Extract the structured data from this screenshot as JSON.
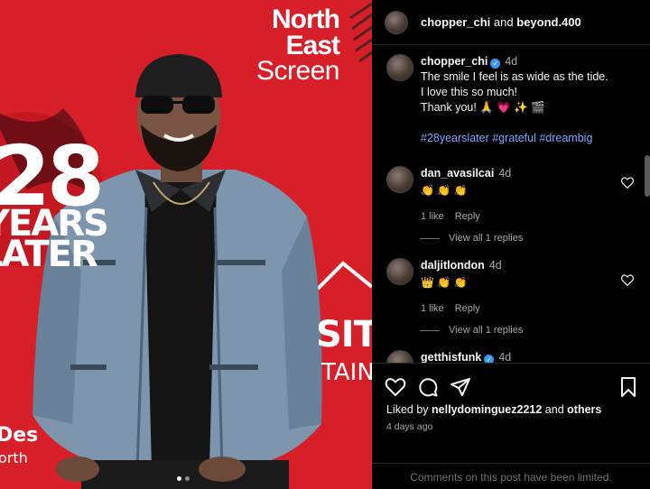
{
  "backdrop": {
    "north": "North",
    "east": "East",
    "screen": "Screen",
    "big_number": "28",
    "years_fragment": "YEARS",
    "later_fragment": "LATER",
    "right_fragment_1": "SIT",
    "right_fragment_2": "TAIN",
    "left_fragment_1": "Des",
    "left_fragment_2": "orth"
  },
  "carousel": {
    "count": 2,
    "active": 0
  },
  "header": {
    "user1": "chopper_chi",
    "joiner": "and",
    "user2": "beyond.400"
  },
  "caption": {
    "username": "chopper_chi",
    "time": "4d",
    "line1": "The smile I feel is as wide as the tide.",
    "line2": "I love this so much!",
    "line3": "Thank you! 🙏 💗 ✨ 🎬",
    "hashtags": "#28yearslater #grateful #dreambig"
  },
  "comments": [
    {
      "username": "dan_avasilcai",
      "time": "4d",
      "text": "👏 👏 👏",
      "likes": "1 like",
      "reply": "Reply",
      "view_replies": "View all 1 replies"
    },
    {
      "username": "daljitlondon",
      "time": "4d",
      "text": "👑 👏 👏",
      "likes": "1 like",
      "reply": "Reply",
      "view_replies": "View all 1 replies"
    },
    {
      "username": "getthisfunk",
      "time": "4d"
    }
  ],
  "footer": {
    "liked_prefix": "Liked by",
    "liked_user": "nellydominguez2212",
    "liked_and": "and",
    "liked_others": "others",
    "post_time": "4 days ago",
    "limited_notice": "Comments on this post have been limited."
  },
  "icons": [
    "heart-icon",
    "comment-icon",
    "share-icon",
    "bookmark-icon",
    "verified-badge-icon"
  ],
  "colors": {
    "banner_red": "#d8222a",
    "link_blue": "#7aa7ff",
    "verified_blue": "#3897f0",
    "muted": "#a8a8a8"
  }
}
